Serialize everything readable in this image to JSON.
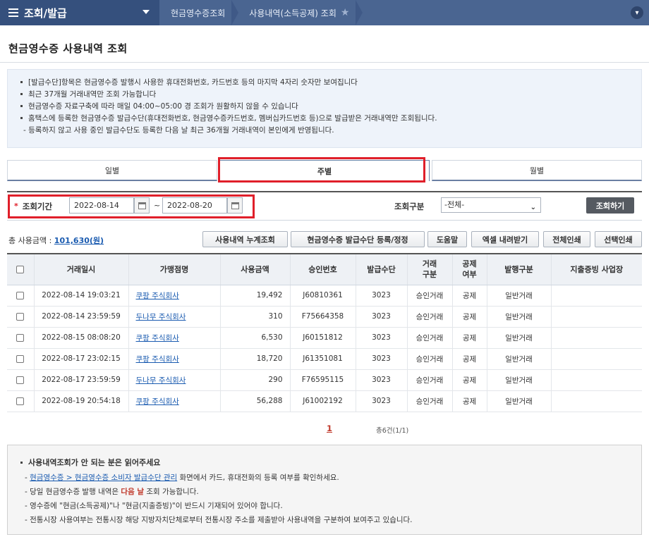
{
  "topbar": {
    "menu_label": "조회/발급",
    "crumbs": [
      "현금영수증조회",
      "사용내역(소득공제) 조회"
    ]
  },
  "page_title": "현금영수증 사용내역 조회",
  "notice": {
    "items": [
      "[발급수단]항목은 현금영수증 발행시 사용한 휴대전화번호, 카드번호 등의 마지막 4자리 숫자만 보여집니다",
      "최근 37개월 거래내역만 조회 가능합니다",
      "현금영수증 자료구축에 따라 매일 04:00~05:00 경 조회가 원활하지 않을 수 있습니다",
      "홈택스에 등록한 현금영수증 발급수단(휴대전화번호, 현금영수증카드번호, 멤버십카드번호 등)으로 발급받은 거래내역만 조회됩니다."
    ],
    "dash_item": "- 등록하지 않고 사용 중인 발급수단도 등록한 다음 날 최근 36개월 거래내역이 본인에게 반영됩니다."
  },
  "tabs": [
    "일별",
    "주별",
    "월별"
  ],
  "search": {
    "required_mark": "*",
    "period_label": "조회기간",
    "start_date": "2022-08-14",
    "end_date": "2022-08-20",
    "tilde": "~",
    "type_label": "조회구분",
    "type_value": "-전체-",
    "search_button": "조회하기"
  },
  "summary": {
    "label": "총 사용금액 : ",
    "amount": "101,630(원)"
  },
  "actions": [
    "사용내역 누계조회",
    "현금영수증 발급수단 등록/정정",
    "도움말",
    "엑셀 내려받기",
    "전체인쇄",
    "선택인쇄"
  ],
  "table": {
    "headers": [
      "거래일시",
      "가맹점명",
      "사용금액",
      "승인번호",
      "발급수단",
      "거래\n구분",
      "공제\n여부",
      "발행구분",
      "지출증빙 사업장"
    ],
    "rows": [
      {
        "date": "2022-08-14 19:03:21",
        "merchant": "쿠팡 주식회사",
        "amount": "19,492",
        "approval": "J60810361",
        "method": "3023",
        "trade": "승인거래",
        "deduct": "공제",
        "issue": "일반거래",
        "biz": ""
      },
      {
        "date": "2022-08-14 23:59:59",
        "merchant": "두나무 주식회사",
        "amount": "310",
        "approval": "F75664358",
        "method": "3023",
        "trade": "승인거래",
        "deduct": "공제",
        "issue": "일반거래",
        "biz": ""
      },
      {
        "date": "2022-08-15 08:08:20",
        "merchant": "쿠팡 주식회사",
        "amount": "6,530",
        "approval": "J60151812",
        "method": "3023",
        "trade": "승인거래",
        "deduct": "공제",
        "issue": "일반거래",
        "biz": ""
      },
      {
        "date": "2022-08-17 23:02:15",
        "merchant": "쿠팡 주식회사",
        "amount": "18,720",
        "approval": "J61351081",
        "method": "3023",
        "trade": "승인거래",
        "deduct": "공제",
        "issue": "일반거래",
        "biz": ""
      },
      {
        "date": "2022-08-17 23:59:59",
        "merchant": "두나무 주식회사",
        "amount": "290",
        "approval": "F76595115",
        "method": "3023",
        "trade": "승인거래",
        "deduct": "공제",
        "issue": "일반거래",
        "biz": ""
      },
      {
        "date": "2022-08-19 20:54:18",
        "merchant": "쿠팡 주식회사",
        "amount": "56,288",
        "approval": "J61002192",
        "method": "3023",
        "trade": "승인거래",
        "deduct": "공제",
        "issue": "일반거래",
        "biz": ""
      }
    ]
  },
  "pagination": {
    "current": "1",
    "count_text": "총6건(1/1)"
  },
  "help": {
    "title": "사용내역조회가 안 되는 분은 읽어주세요",
    "line1_link": "현금영수증 > 현금영수증 소비자 발급수단 관리",
    "line1_rest": " 화면에서 카드, 휴대전화의 등록 여부를 확인하세요.",
    "line2_pre": "당일 현금영수증 발행 내역은 ",
    "line2_red": "다음 날",
    "line2_post": " 조회 가능합니다.",
    "line3": "영수증에 \"현금(소득공제)\"나 \"현금(지출증빙)\"이 반드시 기재되어 있어야 합니다.",
    "line4": "전통시장 사용여부는 전통시장 해당 지방자치단체로부터 전통시장 주소를 제출받아 사용내역을 구분하여 보여주고 있습니다.",
    "dash": "- "
  }
}
